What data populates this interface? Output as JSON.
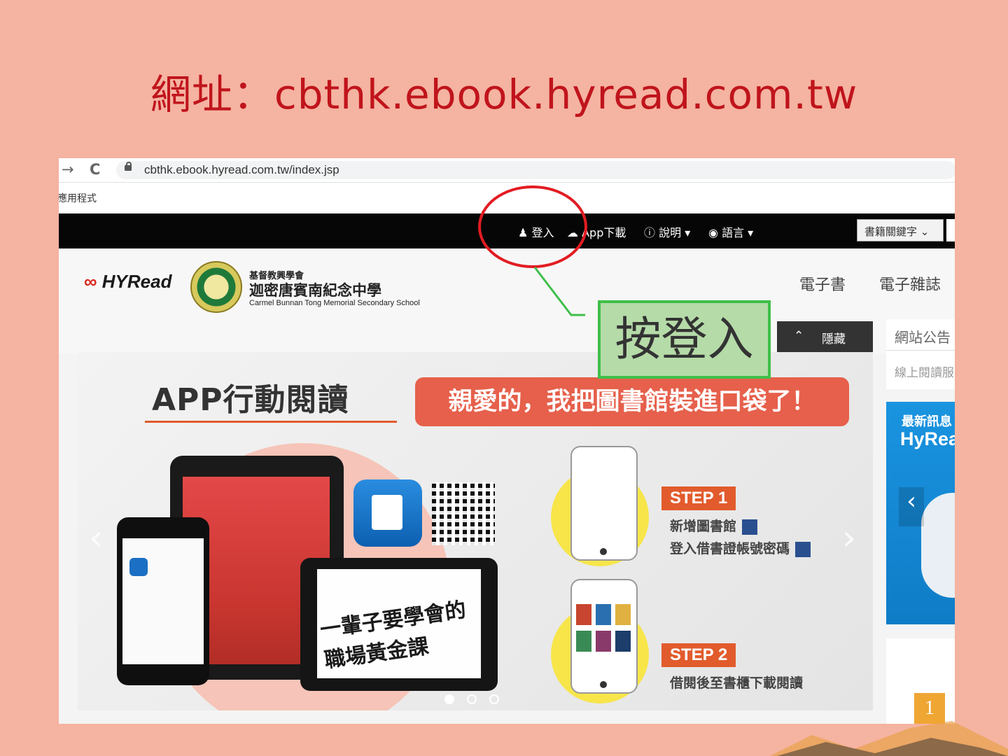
{
  "slide": {
    "title": "網址：cbthk.ebook.hyread.com.tw",
    "callout": "按登入",
    "page_number": "1"
  },
  "browser": {
    "back_glyph": "→",
    "reload_glyph": "C",
    "url": "cbthk.ebook.hyread.com.tw/index.jsp",
    "bookmark": "應用程式"
  },
  "topbar": {
    "login": "登入",
    "app_download": "App下載",
    "help": "說明",
    "language": "語言",
    "keyword_select": "書籍關鍵字"
  },
  "header": {
    "brand": "HYRead",
    "school_line1": "基督教興學會",
    "school_line2": "迦密唐賓南紀念中學",
    "school_line3": "Carmel Bunnan Tong Memorial Secondary School",
    "nav_ebook": "電子書",
    "nav_emag": "電子雜誌"
  },
  "sidebar": {
    "hide_label": "隱藏",
    "notice_title": "網站公告",
    "notice_item": "線上閱讀服",
    "news_title": "最新訊息",
    "news_brand": "HyRea"
  },
  "banner": {
    "app_title": "APP行動閱讀",
    "slogan": "親愛的，我把圖書館裝進口袋了！",
    "tablet_text": "一輩子要學會的職場黃金課",
    "step1_label": "STEP 1",
    "step1_line1": "新增圖書館",
    "step1_line2": "登入借書證帳號密碼",
    "step2_label": "STEP 2",
    "step2_line1": "借閱後至書櫃下載閱讀",
    "prev_glyph": "‹",
    "next_glyph": "›",
    "slides_total": 3,
    "slide_active": 1
  },
  "colors": {
    "slide_bg": "#f5b3a1",
    "title": "#c0141c",
    "annotation_circle": "#e21c22",
    "callout_bg": "#b5dba8",
    "callout_border": "#3fbf4a",
    "step_orange": "#e25b2c"
  }
}
